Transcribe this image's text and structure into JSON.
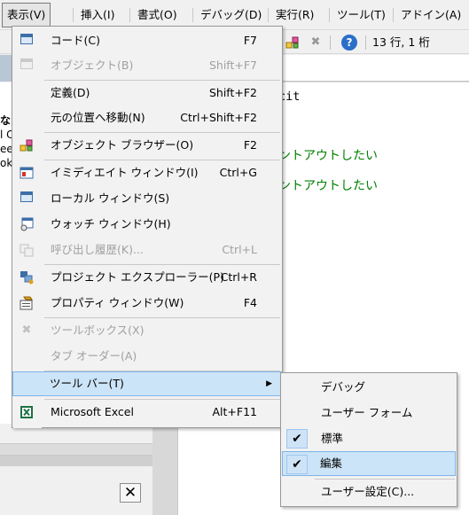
{
  "menubar": {
    "items": [
      {
        "label": "表示(V)",
        "active": true
      },
      {
        "label": "挿入(I)"
      },
      {
        "label": "書式(O)"
      },
      {
        "label": "デバッグ(D)"
      },
      {
        "label": "実行(R)"
      },
      {
        "label": "ツール(T)"
      },
      {
        "label": "アドイン(A)"
      }
    ]
  },
  "toolbar": {
    "position": "13 行, 1 桁",
    "help": "?"
  },
  "code": {
    "lines": [
      {
        "text": "cit",
        "type": "code"
      },
      {
        "text": "ントアウトしたい",
        "type": "comment"
      },
      {
        "text": "ントアウトしたい",
        "type": "comment"
      }
    ]
  },
  "left_panel": {
    "clipped_text": [
      "な",
      "l C",
      "ee",
      "ok"
    ],
    "close_label": "✕"
  },
  "view_menu": {
    "items": [
      {
        "label": "コード(C)",
        "shortcut": "F7",
        "icon": "code-window-icon",
        "enabled": true
      },
      {
        "label": "オブジェクト(B)",
        "shortcut": "Shift+F7",
        "icon": "object-icon",
        "enabled": false
      },
      {
        "label": "定義(D)",
        "shortcut": "Shift+F2",
        "enabled": true
      },
      {
        "label": "元の位置へ移動(N)",
        "shortcut": "Ctrl+Shift+F2",
        "enabled": true
      },
      {
        "label": "オブジェクト ブラウザー(O)",
        "shortcut": "F2",
        "icon": "object-browser-icon",
        "enabled": true
      },
      {
        "label": "イミディエイト ウィンドウ(I)",
        "shortcut": "Ctrl+G",
        "icon": "immediate-window-icon",
        "enabled": true
      },
      {
        "label": "ローカル ウィンドウ(S)",
        "shortcut": "",
        "icon": "locals-window-icon",
        "enabled": true
      },
      {
        "label": "ウォッチ ウィンドウ(H)",
        "shortcut": "",
        "icon": "watch-window-icon",
        "enabled": true
      },
      {
        "label": "呼び出し履歴(K)...",
        "shortcut": "Ctrl+L",
        "icon": "call-stack-icon",
        "enabled": false
      },
      {
        "label": "プロジェクト エクスプローラー(P)",
        "shortcut": "Ctrl+R",
        "icon": "project-explorer-icon",
        "enabled": true
      },
      {
        "label": "プロパティ ウィンドウ(W)",
        "shortcut": "F4",
        "icon": "properties-window-icon",
        "enabled": true
      },
      {
        "label": "ツールボックス(X)",
        "shortcut": "",
        "icon": "toolbox-icon",
        "enabled": false
      },
      {
        "label": "タブ オーダー(A)",
        "shortcut": "",
        "enabled": false
      },
      {
        "label": "ツール バー(T)",
        "shortcut": "",
        "submenu": true,
        "enabled": true
      },
      {
        "label": "Microsoft Excel",
        "shortcut": "Alt+F11",
        "icon": "excel-icon",
        "enabled": true
      }
    ]
  },
  "toolbar_submenu": {
    "items": [
      {
        "label": "デバッグ",
        "checked": false
      },
      {
        "label": "ユーザー フォーム",
        "checked": false
      },
      {
        "label": "標準",
        "checked": true
      },
      {
        "label": "編集",
        "checked": true,
        "highlighted": true
      },
      {
        "label": "ユーザー設定(C)...",
        "checked": false
      }
    ]
  },
  "colors": {
    "menu_highlight": "#cce4f7",
    "comment": "#008000",
    "disabled_text": "#a0a0a0"
  }
}
